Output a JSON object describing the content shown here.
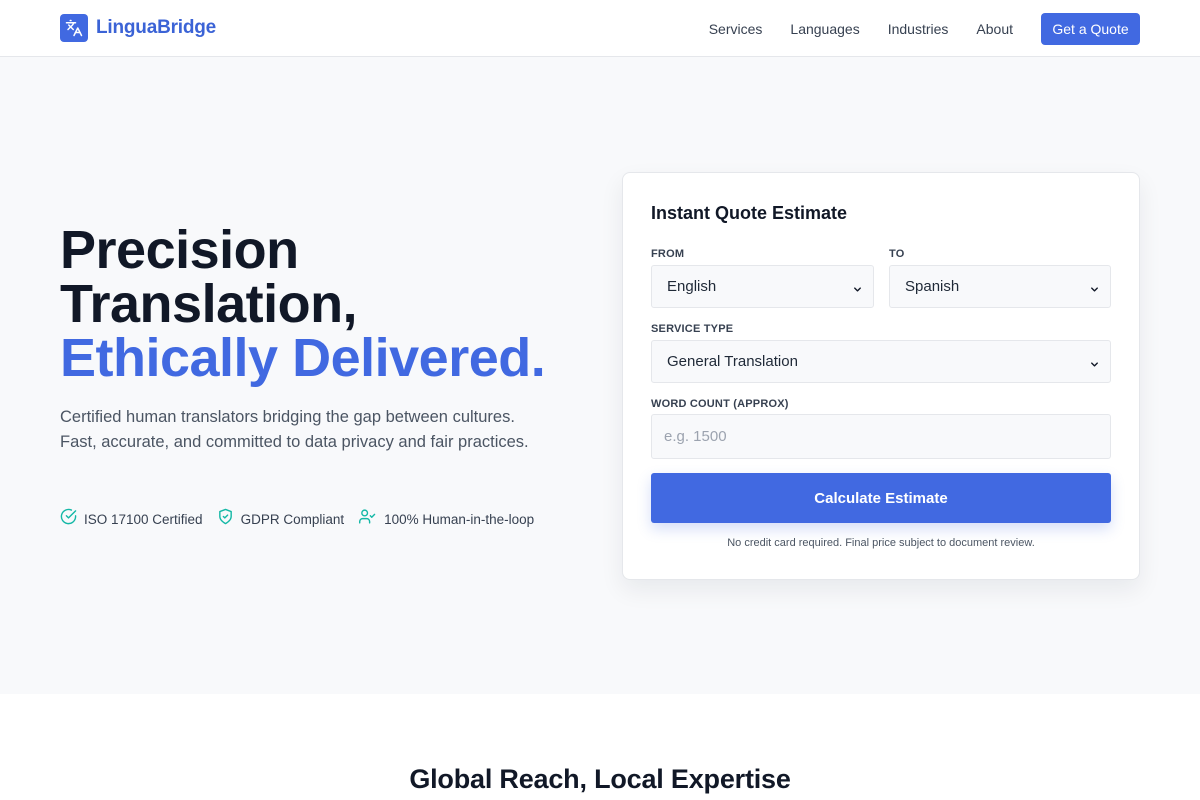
{
  "header": {
    "brand": "LinguaBridge",
    "nav": [
      "Services",
      "Languages",
      "Industries",
      "About"
    ],
    "cta": "Get a Quote"
  },
  "hero": {
    "headline_line1": "Precision",
    "headline_line2": "Translation,",
    "headline_accent": "Ethically Delivered.",
    "description": "Certified human translators bridging the gap between cultures. Fast, accurate, and committed to data privacy and fair practices.",
    "badges": [
      {
        "label": "ISO 17100 Certified",
        "icon": "check-circle-icon"
      },
      {
        "label": "GDPR Compliant",
        "icon": "shield-check-icon"
      },
      {
        "label": "100% Human-in-the-loop",
        "icon": "user-check-icon"
      }
    ]
  },
  "quote_form": {
    "title": "Instant Quote Estimate",
    "from_label": "FROM",
    "from_value": "English",
    "to_label": "TO",
    "to_value": "Spanish",
    "service_label": "SERVICE TYPE",
    "service_value": "General Translation",
    "word_count_label": "WORD COUNT (APPROX)",
    "word_count_placeholder": "e.g. 1500",
    "submit_label": "Calculate Estimate",
    "disclaimer": "No credit card required. Final price subject to document review."
  },
  "next_section": {
    "title": "Global Reach, Local Expertise"
  },
  "colors": {
    "accent": "#4169e1",
    "badge_icon": "#14b8a6",
    "hero_bg": "#f8f9fb"
  }
}
